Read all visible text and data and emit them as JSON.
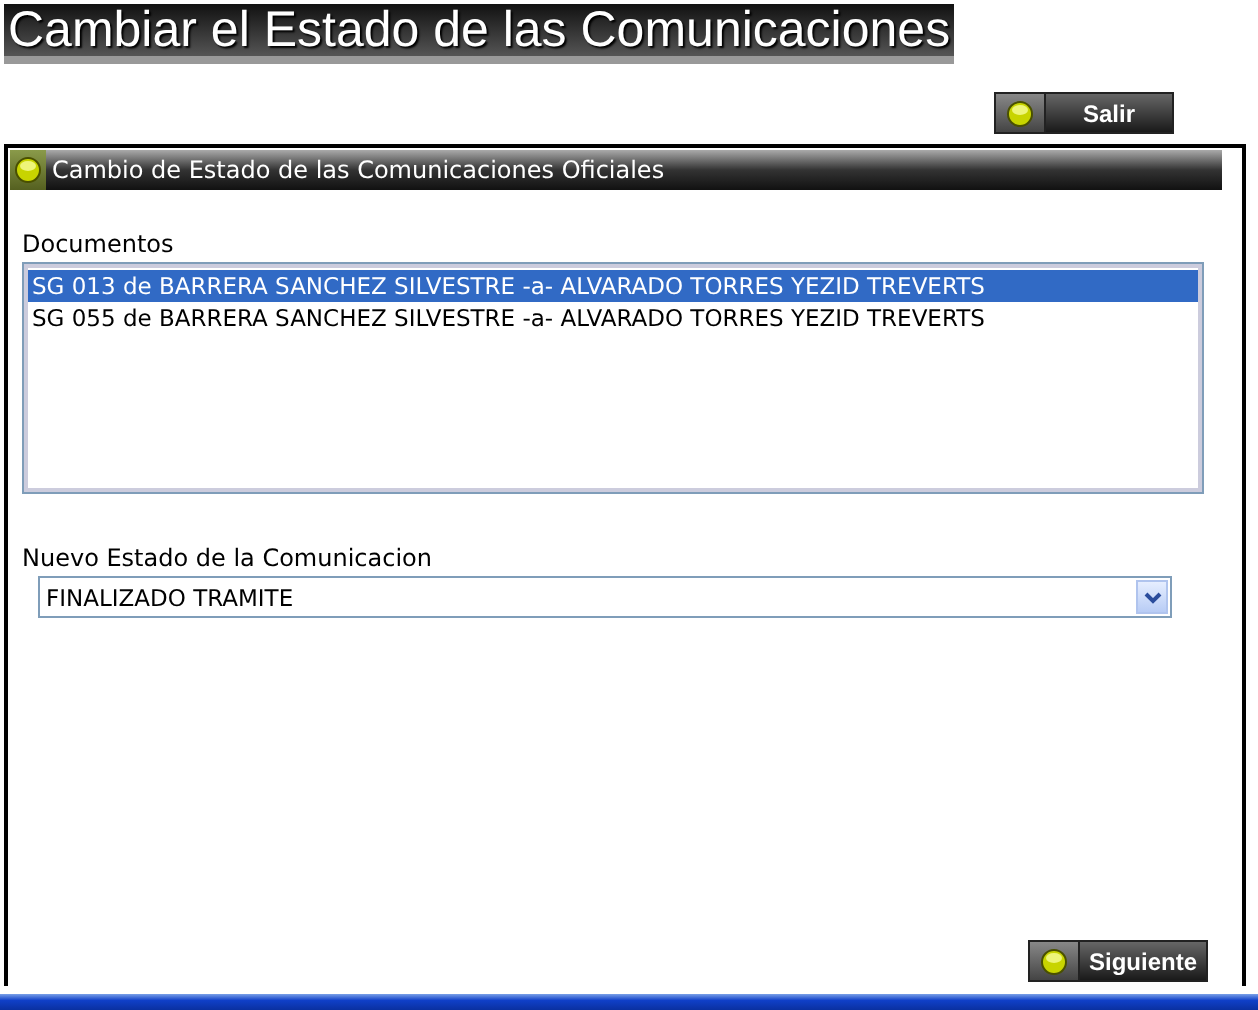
{
  "page_title": "Cambiar el Estado de las Comunicaciones",
  "exit_button": "Salir",
  "panel": {
    "title": "Cambio de Estado de las Comunicaciones Oficiales",
    "documents": {
      "label": "Documentos",
      "items": [
        {
          "text": "SG 013 de BARRERA SANCHEZ SILVESTRE -a- ALVARADO TORRES YEZID TREVERTS",
          "selected": true
        },
        {
          "text": "SG 055 de BARRERA SANCHEZ SILVESTRE -a- ALVARADO TORRES YEZID TREVERTS",
          "selected": false
        }
      ]
    },
    "status": {
      "label": "Nuevo Estado de la Comunicacion",
      "value": "FINALIZADO TRAMITE"
    },
    "next_button": "Siguiente"
  }
}
